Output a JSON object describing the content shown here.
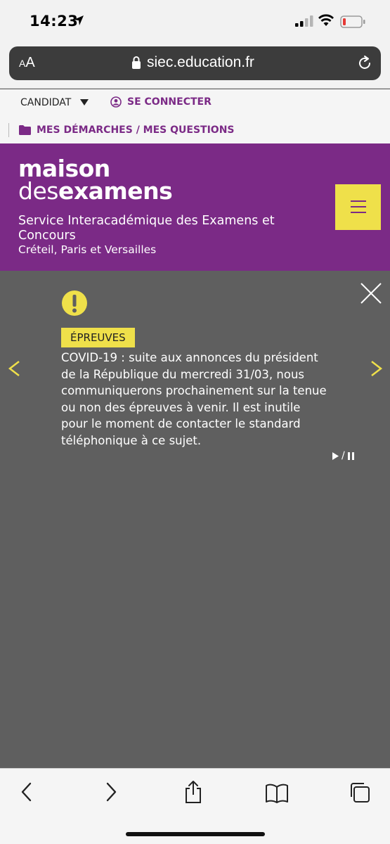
{
  "status": {
    "time": "14:23"
  },
  "browser": {
    "aa_small": "A",
    "aa_large": "A",
    "url": "siec.education.fr"
  },
  "top_links": {
    "candidat": "CANDIDAT",
    "connect": "SE CONNECTER",
    "demarches": "MES DÉMARCHES / MES QUESTIONS"
  },
  "header": {
    "logo_line1": "maison",
    "logo_line2_prefix": "des",
    "logo_line2_bold": "examens",
    "service": "Service Interacadémique des Examens et Concours",
    "region": "Créteil, Paris et Versailles"
  },
  "alert": {
    "badge": "ÉPREUVES",
    "message": "COVID-19 : suite aux annonces du président de la République du mercredi 31/03, nous communiquerons prochainement sur la tenue ou non des épreuves à venir. Il est inutile pour le moment de contacter le standard téléphonique à ce sujet.",
    "play_pause_separator": "/"
  },
  "colors": {
    "brand_purple": "#7b2a86",
    "accent_yellow": "#efe04a",
    "overlay_gray": "#5f5f5f"
  },
  "icons": [
    "location-arrow-icon",
    "signal-icon",
    "wifi-icon",
    "battery-icon",
    "lock-icon",
    "reload-icon",
    "caret-down-icon",
    "user-circle-icon",
    "folder-icon",
    "menu-icon",
    "close-icon",
    "warning-icon",
    "chevron-left-icon",
    "chevron-right-icon",
    "play-icon",
    "pause-icon",
    "back-icon",
    "forward-icon",
    "share-icon",
    "bookmarks-icon",
    "tabs-icon"
  ]
}
